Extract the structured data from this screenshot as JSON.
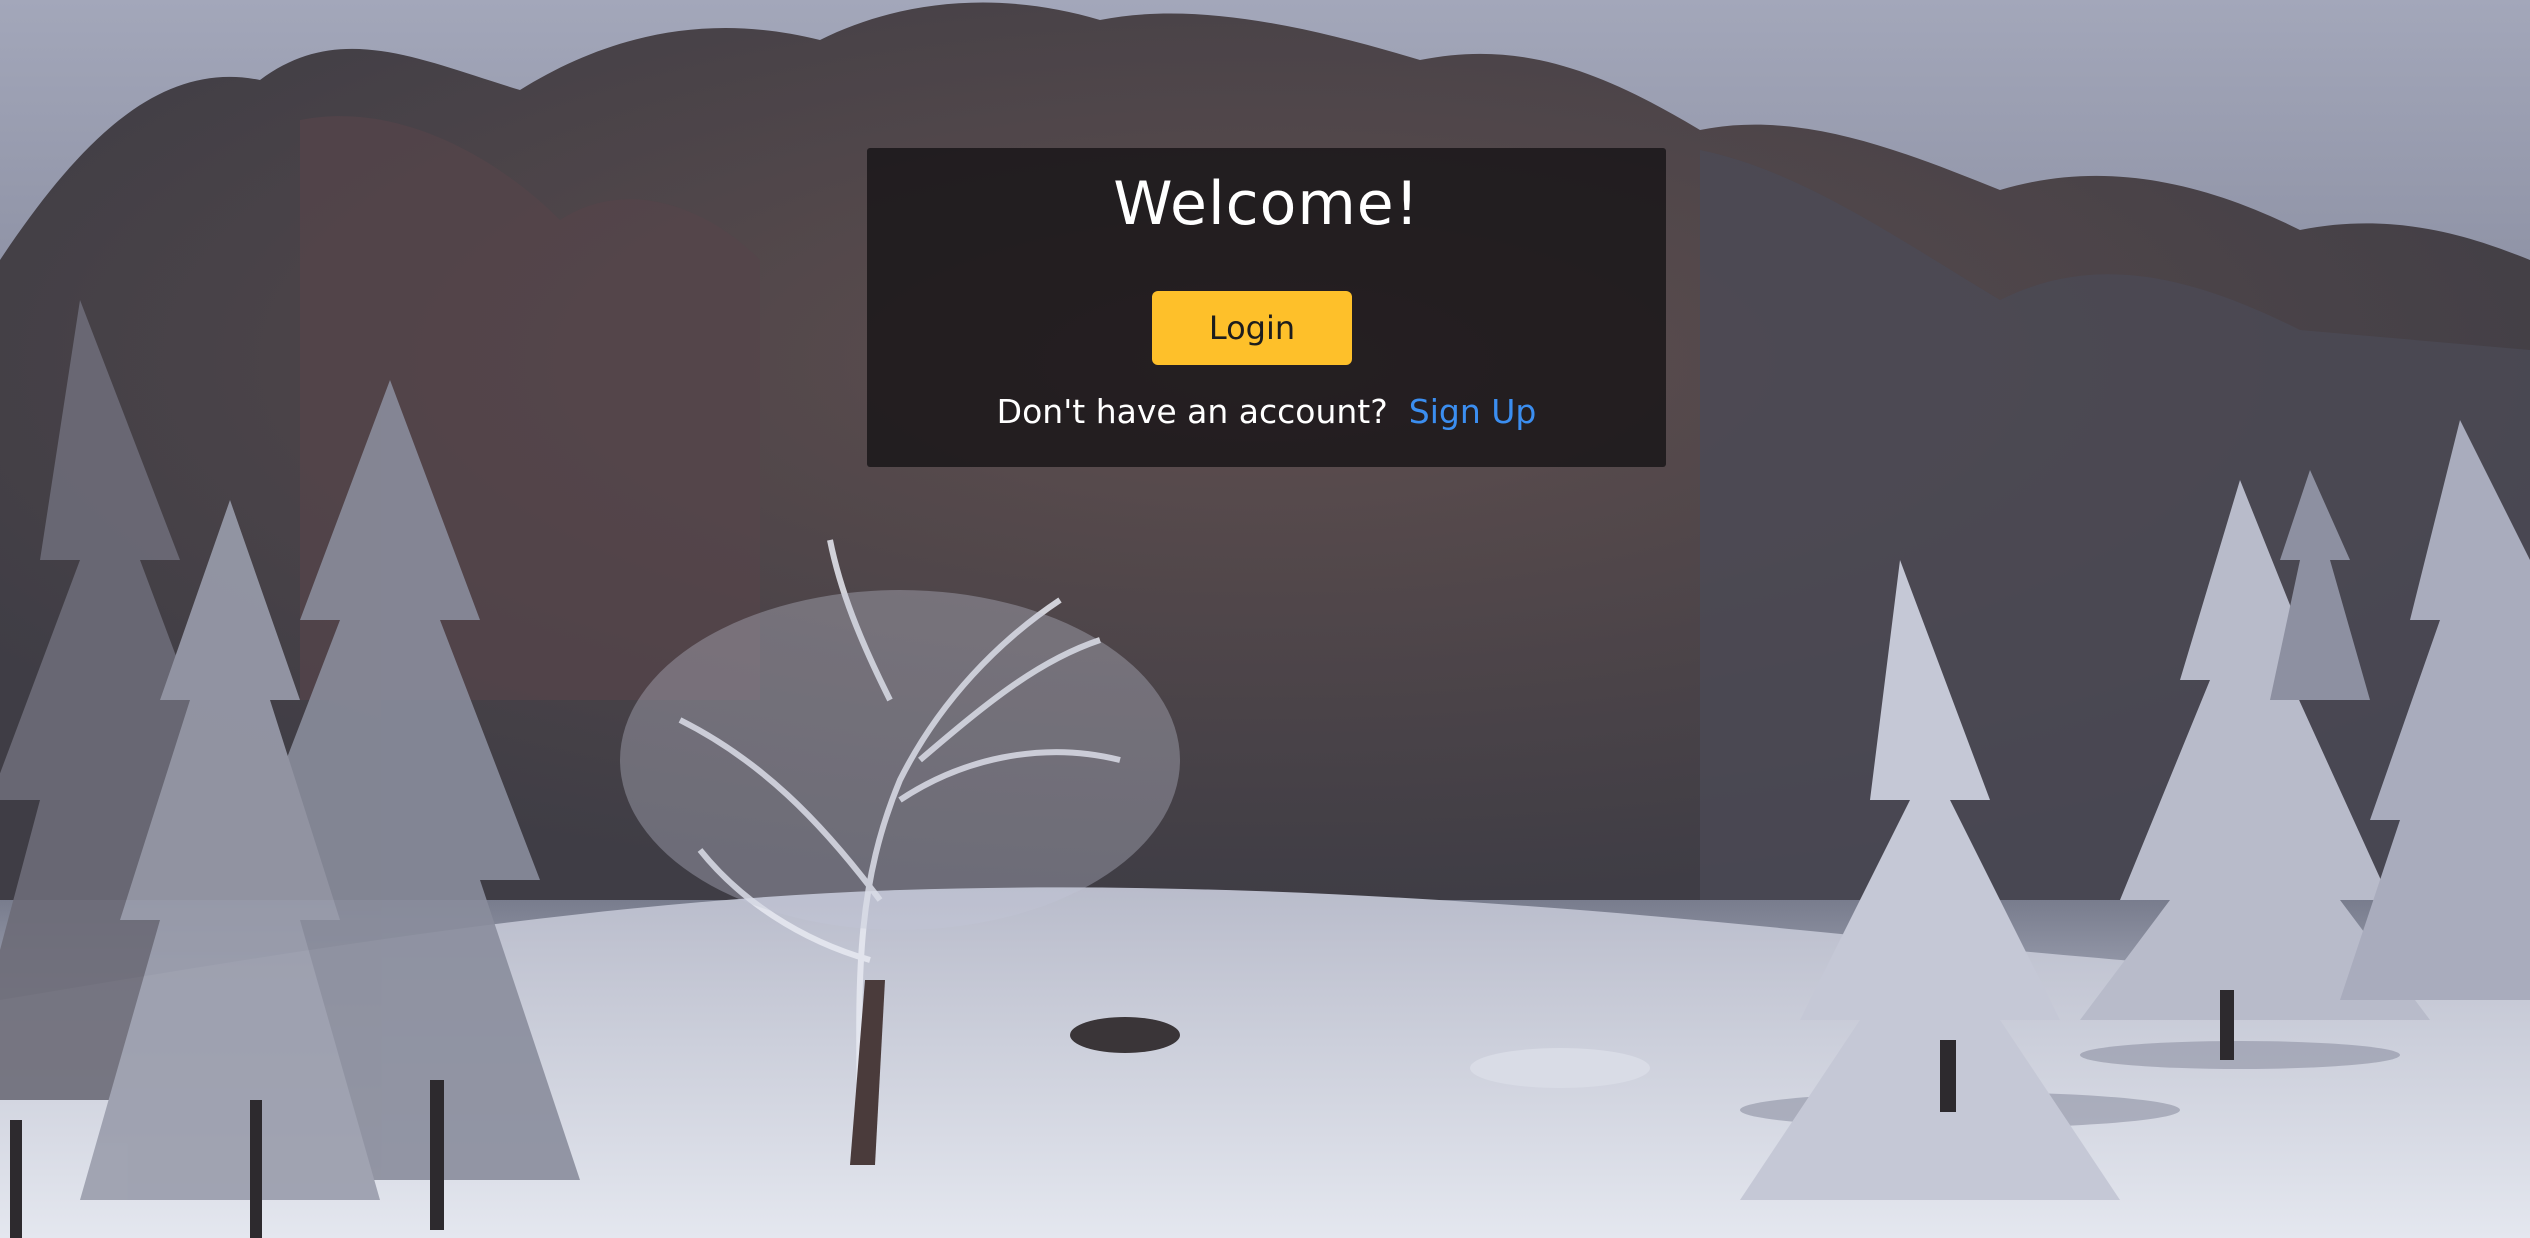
{
  "background": {
    "description_icon": "snowy-forest-photo",
    "sky_color": "#a7abbd",
    "snow_color": "#dfe2ec"
  },
  "card": {
    "title": "Welcome!",
    "login_label": "Login",
    "signup_prompt": "Don't have an account?",
    "signup_link": "Sign Up",
    "background_color": "rgba(20,18,20,0.78)",
    "button_color": "#fec02a",
    "link_color": "#3b8ef0"
  }
}
